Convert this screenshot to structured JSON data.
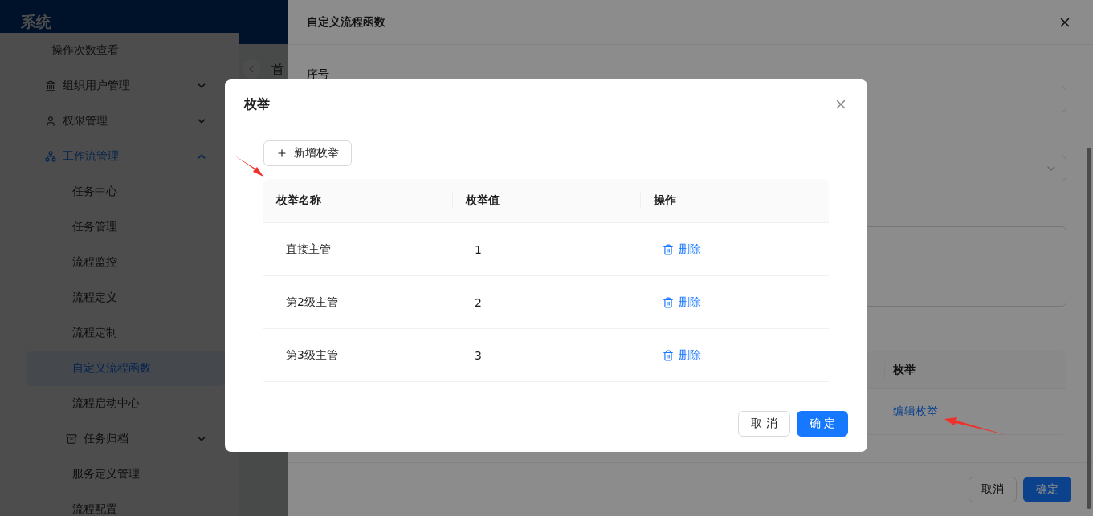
{
  "app_title": "系统",
  "sidebar": {
    "items": [
      {
        "kind": "leaf",
        "label": "操作次数查看",
        "selected": false
      },
      {
        "kind": "group",
        "label": "组织用户管理",
        "expanded": false
      },
      {
        "kind": "group",
        "label": "权限管理",
        "expanded": false
      },
      {
        "kind": "group",
        "label": "工作流管理",
        "expanded": true,
        "children": [
          {
            "kind": "leaf",
            "label": "任务中心",
            "selected": false
          },
          {
            "kind": "leaf",
            "label": "任务管理",
            "selected": false
          },
          {
            "kind": "leaf",
            "label": "流程监控",
            "selected": false
          },
          {
            "kind": "leaf",
            "label": "流程定义",
            "selected": false
          },
          {
            "kind": "leaf",
            "label": "流程定制",
            "selected": false
          },
          {
            "kind": "leaf",
            "label": "自定义流程函数",
            "selected": true
          },
          {
            "kind": "leaf",
            "label": "流程启动中心",
            "selected": false
          },
          {
            "kind": "group",
            "label": "任务归档",
            "expanded": false
          },
          {
            "kind": "leaf",
            "label": "服务定义管理",
            "selected": false
          },
          {
            "kind": "leaf",
            "label": "流程配置",
            "selected": false
          }
        ]
      }
    ]
  },
  "content": {
    "tab": "首"
  },
  "drawer": {
    "title": "自定义流程函数",
    "fields": [
      {
        "kind": "input",
        "label": "序号"
      },
      {
        "kind": "select"
      },
      {
        "kind": "textarea"
      }
    ],
    "table": {
      "columns": [
        "枚举"
      ],
      "rows": [
        {
          "action": "编辑枚举"
        }
      ]
    },
    "buttons": [
      {
        "label": "取消",
        "primary": false
      },
      {
        "label": "确定",
        "primary": true
      }
    ]
  },
  "modal": {
    "title": "枚举",
    "add_button": "新增枚举",
    "table": {
      "columns": [
        "枚举名称",
        "枚举值",
        "操作"
      ],
      "rows": [
        {
          "name": "直接主管",
          "value": "1",
          "action": "删除"
        },
        {
          "name": "第2级主管",
          "value": "2",
          "action": "删除"
        },
        {
          "name": "第3级主管",
          "value": "3",
          "action": "删除"
        }
      ]
    },
    "buttons": [
      {
        "label": "取 消",
        "primary": false
      },
      {
        "label": "确 定",
        "primary": true
      }
    ]
  }
}
